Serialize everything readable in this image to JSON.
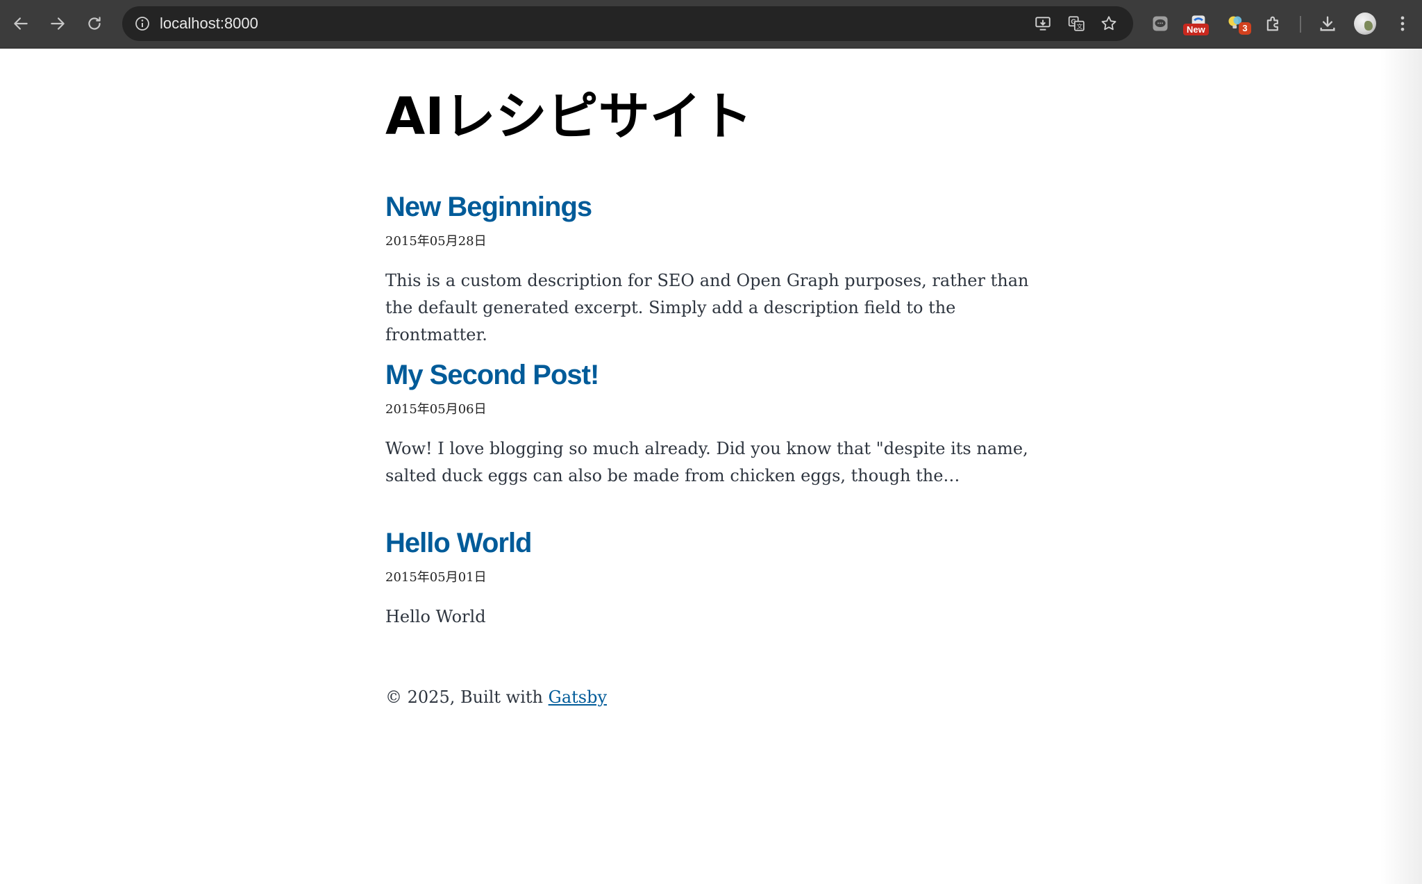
{
  "browser": {
    "url": "localhost:8000",
    "extensions": {
      "new_badge": "New",
      "count_badge": "3"
    },
    "colors": {
      "toolbar": "#3c3c3c",
      "omnibox": "#242424"
    }
  },
  "site": {
    "title": "AIレシピサイト",
    "title_color": "#000000",
    "link_color": "#005b99"
  },
  "posts": [
    {
      "title": "New Beginnings",
      "date": "2015年05月28日",
      "description": "This is a custom description for SEO and Open Graph purposes, rather than the default generated excerpt. Simply add a description field to the frontmatter."
    },
    {
      "title": "My Second Post!",
      "date": "2015年05月06日",
      "description": "Wow! I love blogging so much already. Did you know that \"despite its name, salted duck eggs can also be made from chicken eggs, though the…"
    },
    {
      "title": "Hello World",
      "date": "2015年05月01日",
      "description": "Hello World"
    }
  ],
  "footer": {
    "prefix": "© 2025, Built with ",
    "link_label": "Gatsby"
  }
}
